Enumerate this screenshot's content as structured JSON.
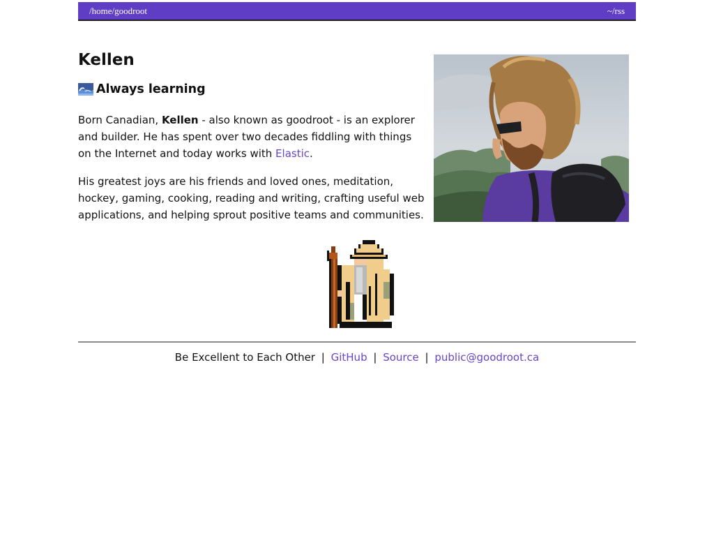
{
  "nav": {
    "home": "/home/goodroot",
    "rss": "~/rss"
  },
  "profile": {
    "name": "Kellen",
    "tagline_icon": "wave-icon",
    "tagline": "Always learning",
    "p1_before": "Born Canadian, ",
    "p1_name": "Kellen",
    "p1_middle": " - also known as goodroot - is an explorer and builder. He has spent over two decades fiddling with things on the Internet and today works with ",
    "p1_link": "Elastic",
    "p1_after": ".",
    "p2": "His greatest joys are his friends and loved ones, meditation, hockey, gaming, cooking, reading and writing, crafting useful web applications, and helping sprout positive teams and communities."
  },
  "images": {
    "portrait": "portrait-photo",
    "mascot": "pixel-wizard-icon"
  },
  "footer": {
    "motto": "Be Excellent to Each Other",
    "sep": "|",
    "github": "GitHub",
    "source": "Source",
    "email": "public@goodroot.ca"
  },
  "colors": {
    "accent": "#5f3dc4",
    "link": "#6a44c9"
  }
}
